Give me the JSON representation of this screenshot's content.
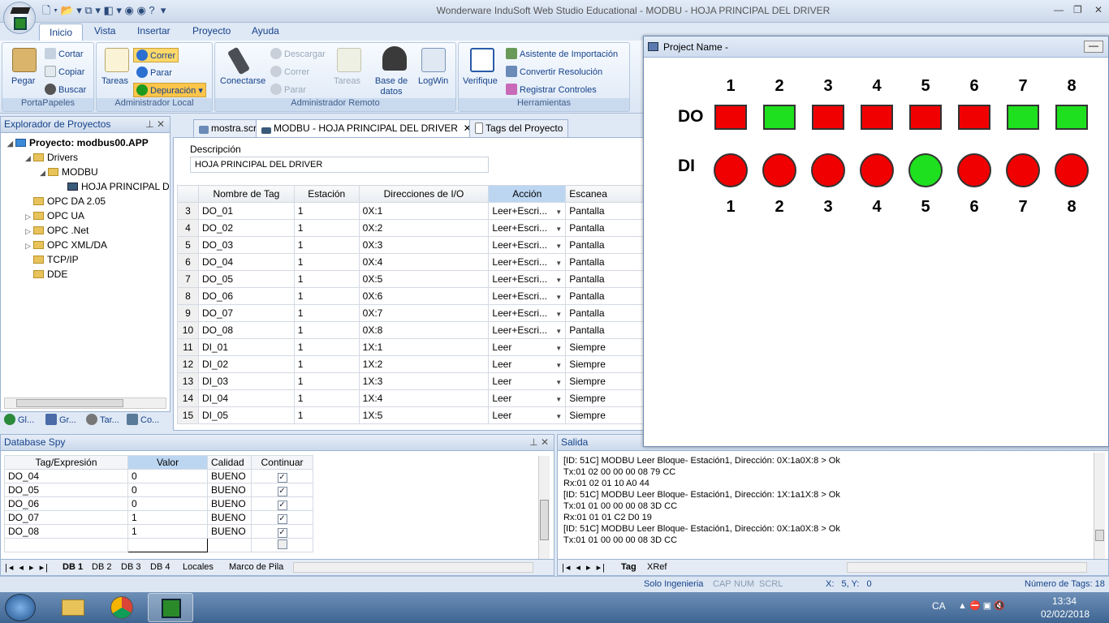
{
  "window": {
    "title": "Wonderware InduSoft Web Studio Educational - MODBU - HOJA PRINCIPAL DEL DRIVER"
  },
  "ribbon": {
    "tabs": [
      "Inicio",
      "Vista",
      "Insertar",
      "Proyecto",
      "Ayuda"
    ],
    "portapapeles": {
      "label": "PortaPapeles",
      "pegar": "Pegar",
      "cortar": "Cortar",
      "copiar": "Copiar",
      "buscar": "Buscar"
    },
    "admin_local": {
      "label": "Administrador Local",
      "tareas": "Tareas",
      "correr": "Correr",
      "parar": "Parar",
      "depuracion": "Depuración"
    },
    "admin_remoto": {
      "label": "Administrador Remoto",
      "conectarse": "Conectarse",
      "descargar": "Descargar",
      "correr": "Correr",
      "parar": "Parar",
      "tareas": "Tareas",
      "base_datos": "Base de datos Espia",
      "logwin": "LogWin"
    },
    "herramientas": {
      "label": "Herramientas",
      "verifique": "Verifique",
      "asistente": "Asistente de Importación",
      "convertir": "Convertir Resolución",
      "registrar": "Registrar Controles"
    }
  },
  "explorer": {
    "title": "Explorador de Proyectos",
    "project": "Proyecto: modbus00.APP",
    "items": [
      "Drivers",
      "MODBU",
      "HOJA PRINCIPAL D",
      "OPC DA 2.05",
      "OPC UA",
      "OPC .Net",
      "OPC XML/DA",
      "TCP/IP",
      "DDE"
    ],
    "bottom_tabs": [
      "Gl...",
      "Gr...",
      "Tar...",
      "Co..."
    ]
  },
  "doc_tabs": [
    "mostra.scr",
    "MODBU - HOJA PRINCIPAL DEL DRIVER",
    "Tags del Proyecto"
  ],
  "driver_sheet": {
    "descripcion_label": "Descripción",
    "descripcion_value": "HOJA PRINCIPAL DEL DRIVER",
    "columns": [
      "Nombre de Tag",
      "Estación",
      "Direcciones de I/O",
      "Acción",
      "Escanea"
    ],
    "rows": [
      {
        "n": "3",
        "tag": "DO_01",
        "st": "1",
        "io": "0X:1",
        "acc": "Leer+Escri...",
        "scan": "Pantalla"
      },
      {
        "n": "4",
        "tag": "DO_02",
        "st": "1",
        "io": "0X:2",
        "acc": "Leer+Escri...",
        "scan": "Pantalla"
      },
      {
        "n": "5",
        "tag": "DO_03",
        "st": "1",
        "io": "0X:3",
        "acc": "Leer+Escri...",
        "scan": "Pantalla"
      },
      {
        "n": "6",
        "tag": "DO_04",
        "st": "1",
        "io": "0X:4",
        "acc": "Leer+Escri...",
        "scan": "Pantalla"
      },
      {
        "n": "7",
        "tag": "DO_05",
        "st": "1",
        "io": "0X:5",
        "acc": "Leer+Escri...",
        "scan": "Pantalla"
      },
      {
        "n": "8",
        "tag": "DO_06",
        "st": "1",
        "io": "0X:6",
        "acc": "Leer+Escri...",
        "scan": "Pantalla"
      },
      {
        "n": "9",
        "tag": "DO_07",
        "st": "1",
        "io": "0X:7",
        "acc": "Leer+Escri...",
        "scan": "Pantalla"
      },
      {
        "n": "10",
        "tag": "DO_08",
        "st": "1",
        "io": "0X:8",
        "acc": "Leer+Escri...",
        "scan": "Pantalla"
      },
      {
        "n": "11",
        "tag": "DI_01",
        "st": "1",
        "io": "1X:1",
        "acc": "Leer",
        "scan": "Siempre"
      },
      {
        "n": "12",
        "tag": "DI_02",
        "st": "1",
        "io": "1X:2",
        "acc": "Leer",
        "scan": "Siempre"
      },
      {
        "n": "13",
        "tag": "DI_03",
        "st": "1",
        "io": "1X:3",
        "acc": "Leer",
        "scan": "Siempre"
      },
      {
        "n": "14",
        "tag": "DI_04",
        "st": "1",
        "io": "1X:4",
        "acc": "Leer",
        "scan": "Siempre"
      },
      {
        "n": "15",
        "tag": "DI_05",
        "st": "1",
        "io": "1X:5",
        "acc": "Leer",
        "scan": "Siempre"
      }
    ]
  },
  "database_spy": {
    "title": "Database Spy",
    "columns": [
      "Tag/Expresión",
      "Valor",
      "Calidad",
      "Continuar"
    ],
    "rows": [
      {
        "tag": "DO_04",
        "val": "0",
        "q": "BUENO"
      },
      {
        "tag": "DO_05",
        "val": "0",
        "q": "BUENO"
      },
      {
        "tag": "DO_06",
        "val": "0",
        "q": "BUENO"
      },
      {
        "tag": "DO_07",
        "val": "1",
        "q": "BUENO"
      },
      {
        "tag": "DO_08",
        "val": "1",
        "q": "BUENO"
      }
    ],
    "sheet_tabs": [
      "DB 1",
      "DB 2",
      "DB 3",
      "DB 4",
      "Locales",
      "Marco de Pila"
    ]
  },
  "output": {
    "title": "Salida",
    "lines": [
      "[ID: 51C] MODBU Leer Bloque- Estación1, Dirección: 0X:1a0X:8 > Ok",
      "Tx:01 02 00 00 00 08 79 CC",
      "Rx:01 02 01 10 A0 44",
      "[ID: 51C] MODBU Leer Bloque- Estación1, Dirección: 1X:1a1X:8 > Ok",
      "Tx:01 01 00 00 00 08 3D CC",
      "Rx:01 01 01 C2 D0 19",
      "[ID: 51C] MODBU Leer Bloque- Estación1, Dirección: 0X:1a0X:8 > Ok",
      "Tx:01 01 00 00 00 08 3D CC"
    ],
    "tabs": [
      "Tag",
      "XRef"
    ]
  },
  "statusbar": {
    "company": "Solo Ingenieria",
    "cap": "CAP",
    "num": "NUM",
    "scrl": "SCRL",
    "coords": "X:   5, Y:   0",
    "tagcount": "Número de Tags: 18"
  },
  "taskbar": {
    "lang": "CA",
    "time": "13:34",
    "date": "02/02/2018"
  },
  "popup": {
    "title": "Project Name -",
    "do_label": "DO",
    "di_label": "DI",
    "numbers": [
      "1",
      "2",
      "3",
      "4",
      "5",
      "6",
      "7",
      "8"
    ],
    "do_states": [
      0,
      1,
      0,
      0,
      0,
      0,
      1,
      1
    ],
    "di_states": [
      0,
      0,
      0,
      0,
      1,
      0,
      0,
      0
    ],
    "on_color": "#1ee01e",
    "off_color": "#f00000"
  }
}
